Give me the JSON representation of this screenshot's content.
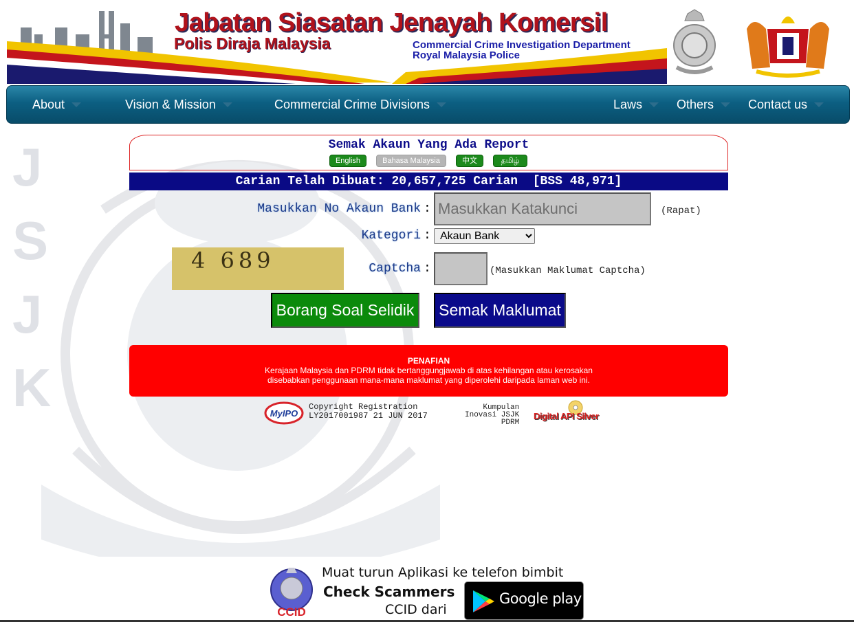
{
  "banner": {
    "title": "Jabatan Siasatan Jenayah Komersil",
    "subtitle": "Polis Diraja Malaysia",
    "english_line1": "Commercial Crime Investigation Department",
    "english_line2": "Royal Malaysia Police"
  },
  "nav": {
    "items": [
      {
        "label": "About"
      },
      {
        "label": "Vision & Mission"
      },
      {
        "label": "Commercial Crime Divisions"
      },
      {
        "label": "Laws"
      },
      {
        "label": "Others"
      },
      {
        "label": "Contact us"
      }
    ]
  },
  "watermark": {
    "side_letters": [
      "J",
      "S",
      "J",
      "K"
    ]
  },
  "search": {
    "title": "Semak Akaun Yang Ada Report",
    "languages": [
      {
        "label": "English",
        "active": true
      },
      {
        "label": "Bahasa Malaysia",
        "active": false
      },
      {
        "label": "中文",
        "active": true
      },
      {
        "label": "தமிழ்",
        "active": true
      }
    ],
    "counter_text": "Carian Telah Dibuat: 20,657,725 Carian  [BSS 48,971]",
    "account_label": "Masukkan No Akaun Bank",
    "account_placeholder": "Masukkan Katakunci",
    "account_hint": "(Rapat)",
    "category_label": "Kategori",
    "category_selected": "Akaun Bank",
    "captcha_label": "Captcha",
    "captcha_code": "4 689",
    "captcha_hint": "(Masukkan Maklumat Captcha)",
    "colon": ":",
    "survey_button": "Borang Soal Selidik",
    "check_button": "Semak Maklumat"
  },
  "disclaimer": {
    "heading": "PENAFIAN",
    "line1": "Kerajaan Malaysia dan PDRM tidak bertanggungjawab di atas kehilangan atau kerosakan",
    "line2": "disebabkan penggunaan mana-mana maklumat yang diperolehi daripada laman web ini."
  },
  "credits": {
    "myipo_logo_text": "MyIPO",
    "copyright_line1": "Copyright Registration",
    "copyright_line2": "LY2017001987 21 JUN 2017",
    "kumpulan_line1": "Kumpulan",
    "kumpulan_line2": "Inovasi JSJK",
    "kumpulan_line3": "PDRM",
    "api_logo": "Digital API Silver"
  },
  "promo": {
    "line1": "Muat turun Aplikasi ke telefon bimbit",
    "line2": "Check Scammers",
    "line3": "CCID dari",
    "badge_text": "CCID",
    "store_label": "Google play"
  },
  "colors": {
    "nav_bg": "#0c5f82",
    "counter_bg": "#0a0a85",
    "disclaimer_bg": "#ff0000",
    "survey_button_bg": "#0b8a0b",
    "check_button_bg": "#0a0a8a",
    "title_red": "#b0121b",
    "english_blue": "#1b1fa8"
  }
}
